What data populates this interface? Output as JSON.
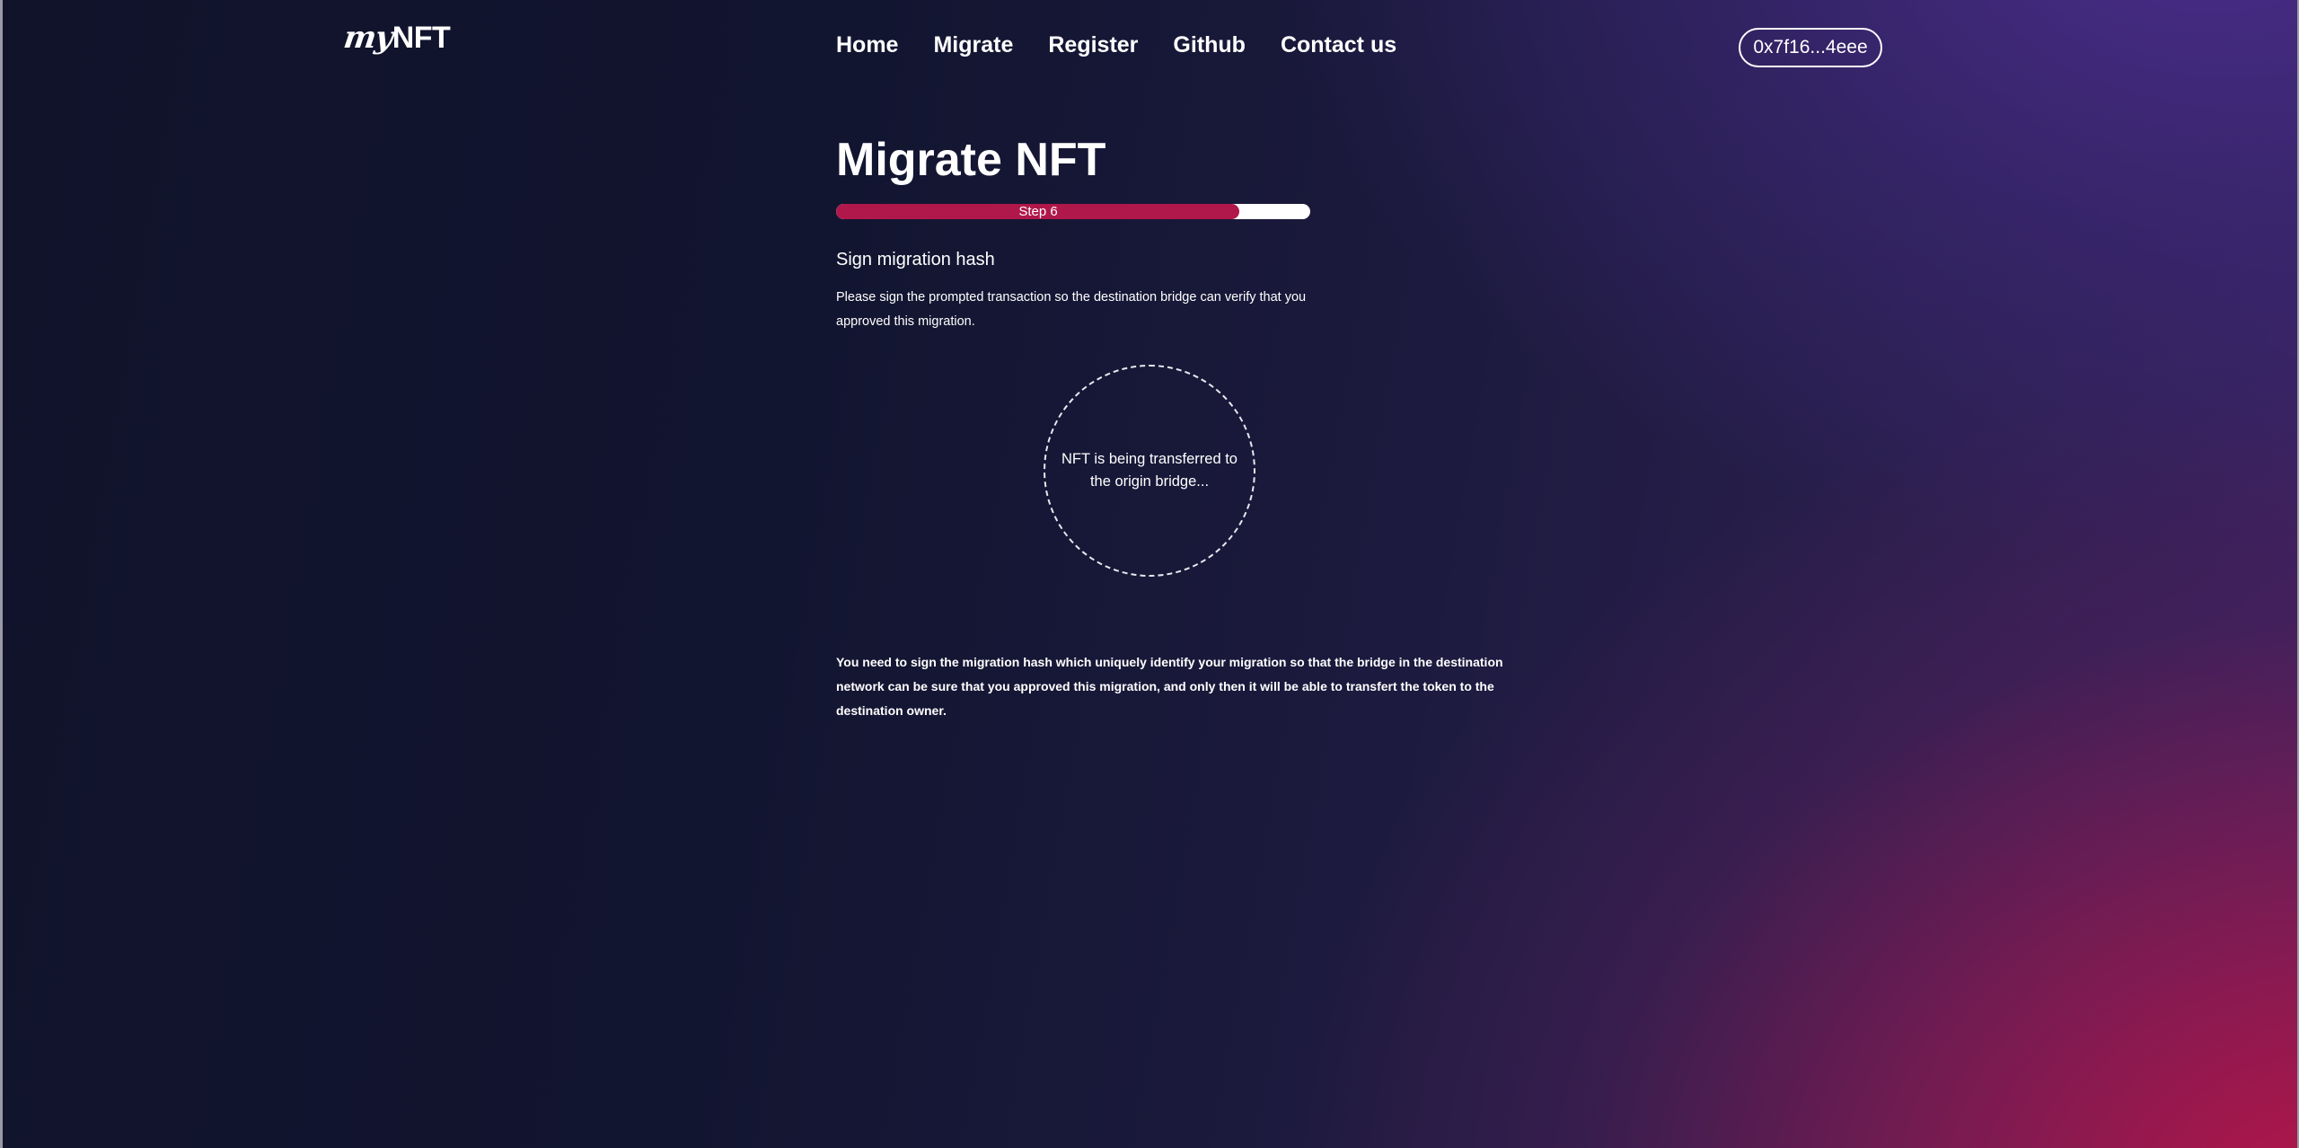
{
  "header": {
    "logo": {
      "prefix": "my",
      "suffix": "NFT"
    },
    "nav": [
      {
        "label": "Home"
      },
      {
        "label": "Migrate"
      },
      {
        "label": "Register"
      },
      {
        "label": "Github"
      },
      {
        "label": "Contact us"
      }
    ],
    "wallet_address": "0x7f16...4eee"
  },
  "main": {
    "title": "Migrate NFT",
    "progress": {
      "label": "Step 6",
      "fraction": 0.85,
      "fill_color": "#b0174a",
      "track_color": "#ffffff"
    },
    "step_heading": "Sign migration hash",
    "step_description": "Please sign the prompted transaction so the destination bridge can verify that you approved this migration.",
    "loader_text": "NFT is being transferred to the origin bridge...",
    "note": "You need to sign the migration hash which uniquely identify your migration so that the bridge in the destination network can be sure that you approved this migration, and only then it will be able to transfert the token to the destination owner."
  }
}
